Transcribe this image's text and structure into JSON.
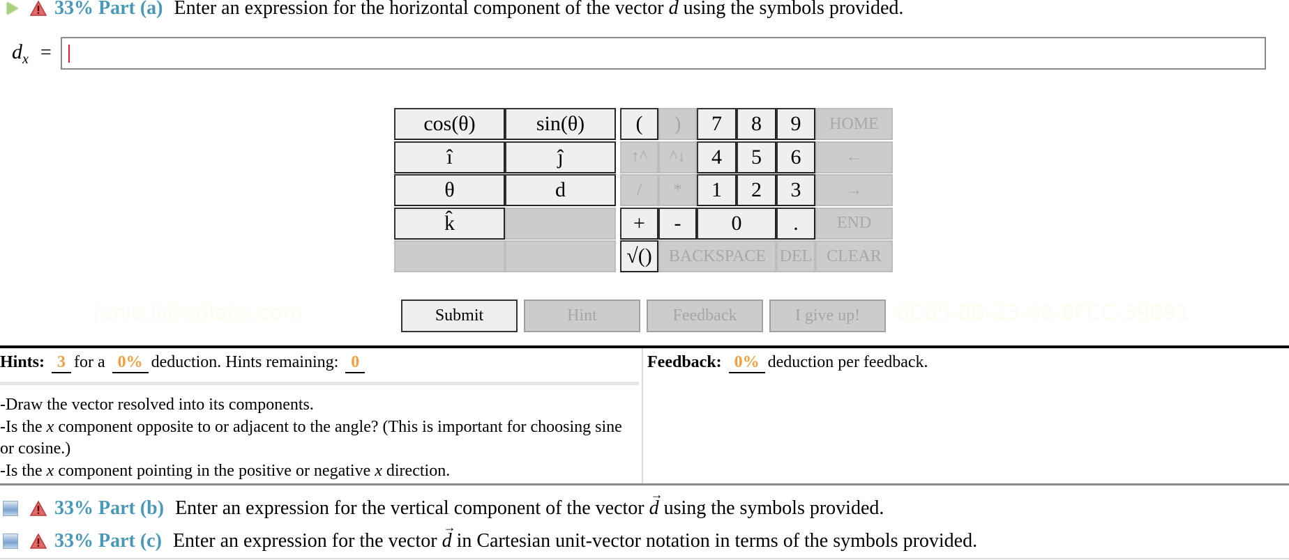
{
  "part_a": {
    "percent": "33%",
    "label": "Part (a)",
    "prompt_before": "Enter an expression for the horizontal component of the vector",
    "vector_symbol": "d",
    "prompt_after": "using the symbols provided.",
    "icons": [
      "play-icon",
      "warning-icon"
    ]
  },
  "answer": {
    "label_var": "d",
    "label_sub": "x",
    "equals": "=",
    "value": ""
  },
  "keypad": {
    "symbol_keys": [
      {
        "label": "cos(θ)",
        "enabled": true
      },
      {
        "label": "sin(θ)",
        "enabled": true
      },
      {
        "label": "î",
        "enabled": true
      },
      {
        "label": "ĵ",
        "enabled": true
      },
      {
        "label": "θ",
        "enabled": true
      },
      {
        "label": "d",
        "enabled": true
      },
      {
        "label": "k̂",
        "enabled": true
      },
      {
        "label": "",
        "enabled": false
      },
      {
        "label": "",
        "enabled": false
      },
      {
        "label": "",
        "enabled": false
      }
    ],
    "open_paren": "(",
    "close_paren": ")",
    "up_caret": "↑^",
    "caret_down": "^↓",
    "divide": "/",
    "multiply": "*",
    "plus": "+",
    "minus": "-",
    "sqrt": "√()",
    "digits": [
      "7",
      "8",
      "9",
      "4",
      "5",
      "6",
      "1",
      "2",
      "3",
      "0"
    ],
    "dot": ".",
    "home": "HOME",
    "left_arrow": "←",
    "right_arrow": "→",
    "end": "END",
    "backspace": "BACKSPACE",
    "del": "DEL",
    "clear": "CLEAR"
  },
  "actions": {
    "submit": "Submit",
    "hint": "Hint",
    "feedback": "Feedback",
    "give_up": "I give up!"
  },
  "watermark": {
    "left": "junle.li@stjlabs.com",
    "right": "6C65-8B-23-48-8FCC-39091"
  },
  "hints": {
    "label": "Hints:",
    "count": "3",
    "for_a": "for a",
    "deduction": "0%",
    "deduction_text": "deduction. Hints remaining:",
    "remaining": "0",
    "items": [
      "-Draw the vector resolved into its components.",
      "-Is the x component opposite to or adjacent to the angle? (This is important for choosing sine or cosine.)",
      "-Is the x component pointing in the positive or negative x direction."
    ]
  },
  "feedback": {
    "label": "Feedback:",
    "deduction": "0%",
    "text": "deduction per feedback."
  },
  "part_b": {
    "percent": "33%",
    "label": "Part (b)",
    "prompt_before": "Enter an expression for the vertical component of the vector",
    "vector_symbol": "d",
    "prompt_after": "using the symbols provided."
  },
  "part_c": {
    "percent": "33%",
    "label": "Part (c)",
    "prompt_before": "Enter an expression for the vector",
    "vector_symbol": "d",
    "prompt_after": "in Cartesian unit-vector notation in terms of the symbols provided."
  },
  "colors": {
    "part_blue": "#4a98b8",
    "value_orange": "#f0a040",
    "warning_red": "#d9534f",
    "play_green": "#a9d17e"
  }
}
